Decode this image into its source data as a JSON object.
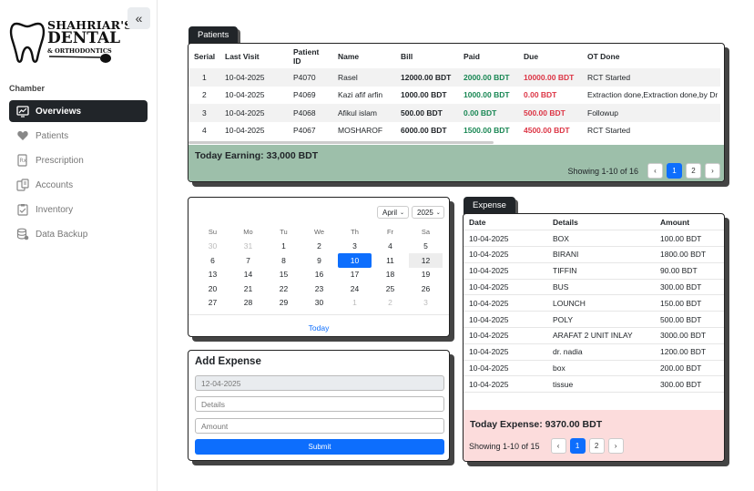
{
  "brand": {
    "line1": "SHAHRIAR'S",
    "line2": "DENTAL",
    "line3": "& ORTHODONTICS"
  },
  "sidebar": {
    "section": "Chamber",
    "items": [
      {
        "label": "Overviews",
        "icon": "chart-icon"
      },
      {
        "label": "Patients",
        "icon": "heart-icon"
      },
      {
        "label": "Prescription",
        "icon": "prescription-icon"
      },
      {
        "label": "Accounts",
        "icon": "accounts-icon"
      },
      {
        "label": "Inventory",
        "icon": "inventory-icon"
      },
      {
        "label": "Data Backup",
        "icon": "database-icon"
      }
    ]
  },
  "patients": {
    "tab": "Patients",
    "columns": [
      "Serial",
      "Last Visit",
      "Patient ID",
      "Name",
      "Bill",
      "Paid",
      "Due",
      "OT Done"
    ],
    "rows": [
      {
        "serial": "1",
        "last_visit": "10-04-2025",
        "patient_id": "P4070",
        "name": "Rasel",
        "bill": "12000.00 BDT",
        "paid": "2000.00 BDT",
        "due": "10000.00 BDT",
        "ot": "RCT Started"
      },
      {
        "serial": "2",
        "last_visit": "10-04-2025",
        "patient_id": "P4069",
        "name": "Kazi afif arfin",
        "bill": "1000.00 BDT",
        "paid": "1000.00 BDT",
        "due": "0.00 BDT",
        "ot": "Extraction done,Extraction done,by Dr N"
      },
      {
        "serial": "3",
        "last_visit": "10-04-2025",
        "patient_id": "P4068",
        "name": "Afikul islam",
        "bill": "500.00 BDT",
        "paid": "0.00 BDT",
        "due": "500.00 BDT",
        "ot": "Followup"
      },
      {
        "serial": "4",
        "last_visit": "10-04-2025",
        "patient_id": "P4067",
        "name": "MOSHAROF",
        "bill": "6000.00 BDT",
        "paid": "1500.00 BDT",
        "due": "4500.00 BDT",
        "ot": "RCT Started"
      }
    ],
    "today_earning": "Today Earning: 33,000 BDT",
    "showing": "Showing 1-10 of 16",
    "pages": [
      "‹",
      "1",
      "2",
      "›"
    ]
  },
  "calendar": {
    "month": "April",
    "year": "2025",
    "dow": [
      "Su",
      "Mo",
      "Tu",
      "We",
      "Th",
      "Fr",
      "Sa"
    ],
    "days": [
      "30",
      "31",
      "1",
      "2",
      "3",
      "4",
      "5",
      "6",
      "7",
      "8",
      "9",
      "10",
      "11",
      "12",
      "13",
      "14",
      "15",
      "16",
      "17",
      "18",
      "19",
      "20",
      "21",
      "22",
      "23",
      "24",
      "25",
      "26",
      "27",
      "28",
      "29",
      "30",
      "1",
      "2",
      "3"
    ],
    "today_label": "Today"
  },
  "add_expense": {
    "title": "Add Expense",
    "date_value": "12-04-2025",
    "details_placeholder": "Details",
    "amount_placeholder": "Amount",
    "submit": "Submit"
  },
  "expense": {
    "tab": "Expense",
    "columns": [
      "Date",
      "Details",
      "Amount"
    ],
    "rows": [
      {
        "date": "10-04-2025",
        "details": "BOX",
        "amount": "100.00 BDT"
      },
      {
        "date": "10-04-2025",
        "details": "BIRANI",
        "amount": "1800.00 BDT"
      },
      {
        "date": "10-04-2025",
        "details": "TIFFIN",
        "amount": "90.00 BDT"
      },
      {
        "date": "10-04-2025",
        "details": "BUS",
        "amount": "300.00 BDT"
      },
      {
        "date": "10-04-2025",
        "details": "LOUNCH",
        "amount": "150.00 BDT"
      },
      {
        "date": "10-04-2025",
        "details": "POLY",
        "amount": "500.00 BDT"
      },
      {
        "date": "10-04-2025",
        "details": "ARAFAT 2 UNIT INLAY",
        "amount": "3000.00 BDT"
      },
      {
        "date": "10-04-2025",
        "details": "dr. nadia",
        "amount": "1200.00 BDT"
      },
      {
        "date": "10-04-2025",
        "details": "box",
        "amount": "200.00 BDT"
      },
      {
        "date": "10-04-2025",
        "details": "tissue",
        "amount": "300.00 BDT"
      }
    ],
    "today_expense": "Today Expense: 9370.00 BDT",
    "showing": "Showing 1-10 of 15",
    "pages": [
      "‹",
      "1",
      "2",
      "›"
    ]
  },
  "colors": {
    "earning_bg": "#9dbfaa",
    "expense_bg": "#fcdcdc",
    "primary": "#0d6efd",
    "dark": "#212529"
  }
}
